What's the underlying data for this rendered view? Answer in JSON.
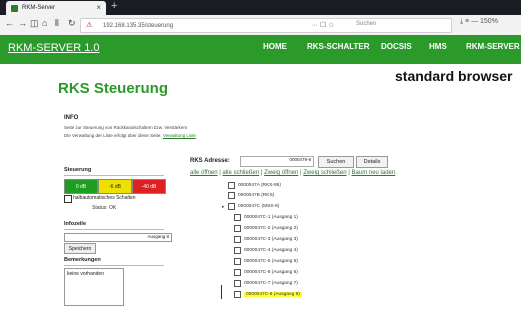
{
  "browser": {
    "tab_title": "RKM-Server",
    "tab_close": "×",
    "new_tab": "+",
    "url": "192.168.135.35/steuerung",
    "url_extras": "··· ☐ ☆",
    "search_placeholder": "Suchen",
    "right_icons": "⤓ ≡ — 150%"
  },
  "header": {
    "brand": "RKM-SERVER 1.0",
    "nav": [
      "HOME",
      "RKS-SCHALTER",
      "DOCSIS",
      "HMS",
      "RKM-SERVER"
    ]
  },
  "overlay_text": "standard browser",
  "page": {
    "title": "RKS Steuerung",
    "info_heading": "INFO",
    "info_line1": "Seite zur Steuerung von Rückkanalschaltern bzw. Verstärkern",
    "info_line2_prefix": "Die Verwaltung der Liste erfolgt über diese Seite: ",
    "info_line2_link": "Verwaltung Liste"
  },
  "steuerung": {
    "heading": "Steuerung",
    "btn_0db": "0 dB",
    "btn_6db": "-6 dB",
    "btn_40db": "-40 dB",
    "checkbox_label": "halbautomatisches Schalten",
    "status": "Status: OK"
  },
  "infozeile": {
    "heading": "Infozeile",
    "value": "Ausgang 8",
    "save": "Speichern"
  },
  "bemerkungen": {
    "heading": "Bemerkungen",
    "text": "keine vorhanden"
  },
  "rks": {
    "label": "RKS Adresse:",
    "input_value": "0000479-8",
    "search": "Suchen",
    "details": "Details",
    "links": [
      "alle öffnen",
      "alle schließen",
      "Zweig öffnen",
      "Zweig schließen",
      "Baum neu laden"
    ],
    "tree": [
      {
        "twisty": "",
        "label": "0000047A (RKS-95)"
      },
      {
        "twisty": "",
        "label": "0000047B (RKS)"
      },
      {
        "twisty": "▸",
        "label": "0000047C (MSS-8)"
      },
      {
        "twisty": "",
        "label": "0000047C-1 (Ausgang 1)"
      },
      {
        "twisty": "",
        "label": "0000047C-2 (Ausgang 2)"
      },
      {
        "twisty": "",
        "label": "0000047C-3 (Ausgang 3)"
      },
      {
        "twisty": "",
        "label": "0000047C-4 (Ausgang 4)"
      },
      {
        "twisty": "",
        "label": "0000047C-5 (Ausgang 5)"
      },
      {
        "twisty": "",
        "label": "0000047C-6 (Ausgang 6)"
      },
      {
        "twisty": "",
        "label": "0000047C-7 (Ausgang 7)"
      },
      {
        "twisty": "",
        "label": "0000047C-8 (Ausgang 8)"
      }
    ]
  },
  "colors": {
    "header": "#2b9a2b",
    "title": "#2a9a2a",
    "btn_0db": "#1e9e1e",
    "btn_6db": "#f0e000",
    "btn_40db": "#e02020",
    "highlight": "#ffff33"
  }
}
